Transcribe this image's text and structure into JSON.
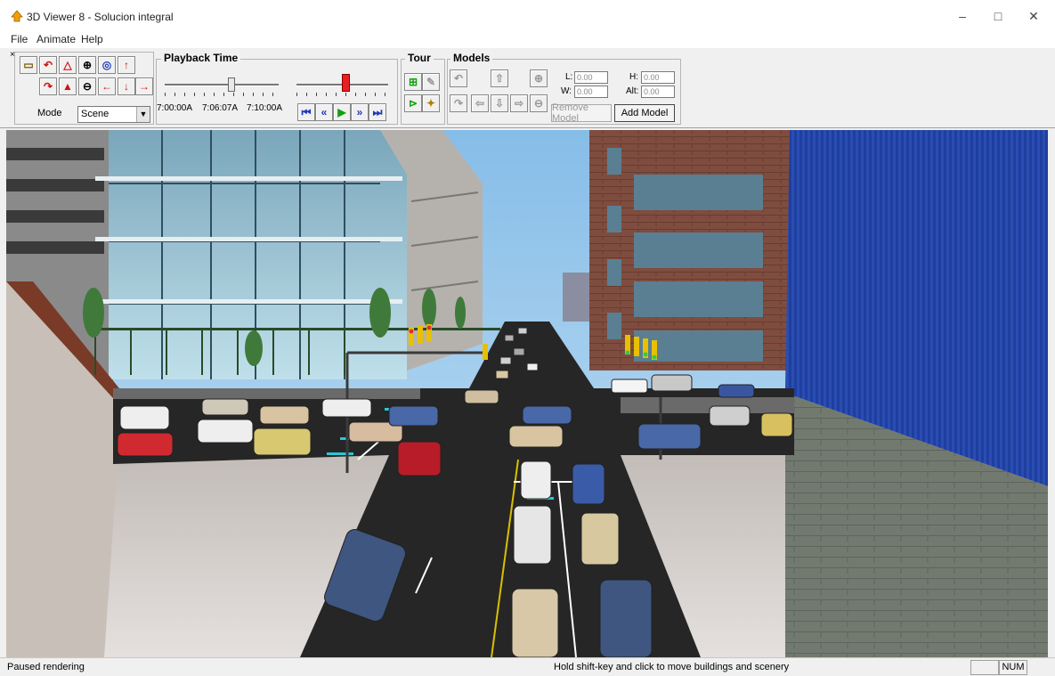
{
  "window": {
    "title": "3D Viewer 8 - Solucion integral",
    "controls": [
      "–",
      "□",
      "✕"
    ]
  },
  "menu": [
    "File",
    "Animate",
    "Help"
  ],
  "toolbar": {
    "close_mark": "×",
    "mode_label": "Mode",
    "mode_value": "Scene",
    "playback": {
      "label": "Playback Time",
      "times": [
        "7:00:00A",
        "7:06:07A",
        "7:10:00A"
      ],
      "position_fraction": 0.58,
      "speed_fraction": 0.52
    },
    "tour_label": "Tour",
    "models": {
      "label": "Models",
      "l_label": "L:",
      "l_value": "0.00",
      "w_label": "W:",
      "w_value": "0.00",
      "h_label": "H:",
      "h_value": "0.00",
      "alt_label": "Alt:",
      "alt_value": "0.00",
      "remove_label": "Remove Model",
      "add_label": "Add Model"
    }
  },
  "status": {
    "left": "Paused rendering",
    "center": "Hold shift-key and click to move buildings and scenery",
    "num": "NUM"
  },
  "colors": {
    "accent_red": "#d01010",
    "sky": "#9ec8ea",
    "road": "#262626",
    "glass_building": "#8ab4c8",
    "brick_building": "#7a4a3c",
    "blue_building": "#1a3a9c"
  }
}
